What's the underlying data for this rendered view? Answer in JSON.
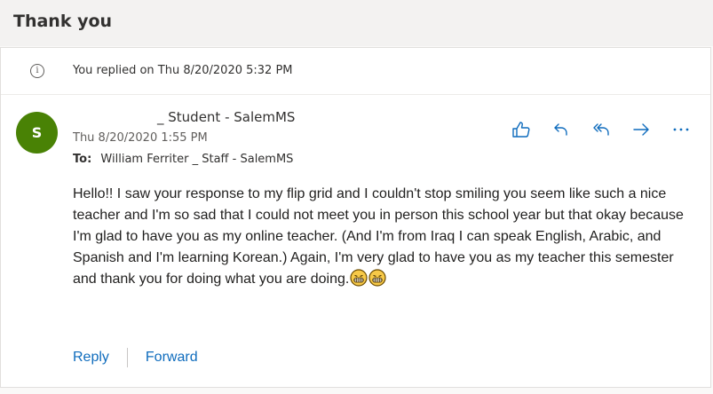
{
  "subject": "Thank you",
  "info": {
    "icon": "info-icon",
    "text": "You replied on Thu 8/20/2020 5:32 PM"
  },
  "message": {
    "avatar_initial": "S",
    "avatar_color": "#498205",
    "sender": "_ Student - SalemMS",
    "date": "Thu 8/20/2020 1:55 PM",
    "to_label": "To:",
    "to_value": "William Ferriter _ Staff - SalemMS",
    "body": "Hello!! I saw your response to my flip grid and I couldn't stop smiling you seem like such a nice teacher and I'm so sad that I could not meet you in person this school year but that okay because I'm glad to have you as my online teacher. (And I'm from Iraq I can speak English, Arabic, and Spanish and I'm learning Korean.) Again, I'm very glad to have you as my teacher this semester and thank you for doing what you are doing.",
    "emojis": [
      "grinning-face-icon",
      "grinning-face-icon"
    ]
  },
  "toolbar": {
    "icons": [
      "like-icon",
      "reply-icon",
      "reply-all-icon",
      "forward-icon",
      "more-icon"
    ]
  },
  "footer": {
    "reply_label": "Reply",
    "forward_label": "Forward"
  },
  "colors": {
    "accent": "#0f6cbd",
    "avatar": "#498205"
  }
}
